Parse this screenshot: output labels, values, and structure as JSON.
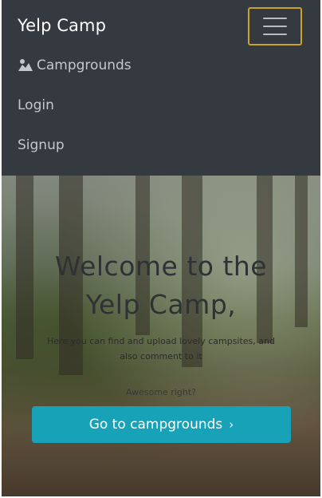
{
  "navbar": {
    "brand": "Yelp Camp",
    "toggle_icon": "hamburger-menu-icon",
    "items": [
      {
        "label": "Campgrounds",
        "icon": "user-landscape-icon"
      },
      {
        "label": "Login"
      },
      {
        "label": "Signup"
      }
    ]
  },
  "hero": {
    "title_line1": "Welcome to the",
    "title_line2": "Yelp Camp,",
    "text_line1": "Here you can find and upload lovely campsites, and",
    "text_line2": "also comment to it",
    "sub": "Awesome right?",
    "cta_label": "Go to campgrounds",
    "cta_icon": "chevron-right-icon"
  },
  "colors": {
    "navbar_bg": "#343a40",
    "toggler_border": "#c9a227",
    "cta_bg": "#17a2b8"
  }
}
